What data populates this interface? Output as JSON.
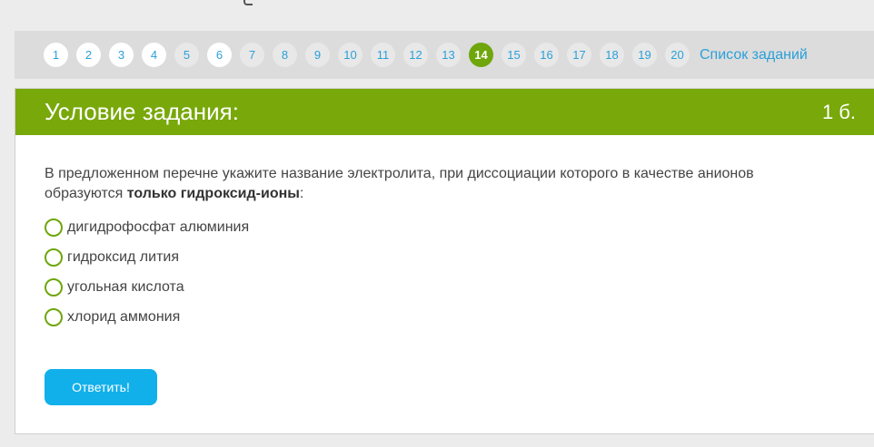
{
  "nav": {
    "numbers": [
      "1",
      "2",
      "3",
      "4",
      "5",
      "6",
      "7",
      "8",
      "9",
      "10",
      "11",
      "12",
      "13",
      "14",
      "15",
      "16",
      "17",
      "18",
      "19",
      "20"
    ],
    "active_index": 13,
    "task_list_label": "Список заданий"
  },
  "task": {
    "title": "Условие задания:",
    "points": "1 б.",
    "question_prefix": "В предложенном перечне укажите название электролита, при диссоциации которого в качестве анионов образуются ",
    "question_bold": "только гидроксид-ионы",
    "question_suffix": ":",
    "options": [
      {
        "label": "дигидрофосфат алюминия"
      },
      {
        "label": "гидроксид лития"
      },
      {
        "label": "угольная кислота"
      },
      {
        "label": "хлорид аммония"
      }
    ],
    "submit_label": "Ответить!"
  },
  "colors": {
    "accent_green": "#78a80a",
    "link_blue": "#2aa0d8",
    "button_blue": "#12b0ea"
  }
}
